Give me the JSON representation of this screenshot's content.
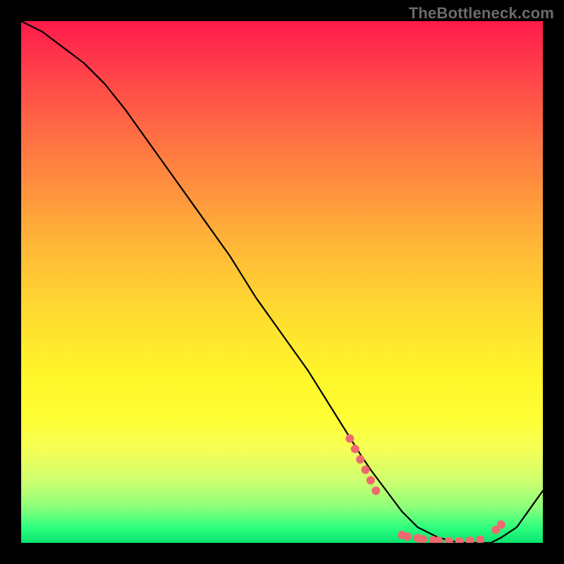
{
  "watermark": "TheBottleneck.com",
  "chart_data": {
    "type": "line",
    "title": "",
    "xlabel": "",
    "ylabel": "",
    "xlim": [
      0,
      100
    ],
    "ylim": [
      0,
      100
    ],
    "series": [
      {
        "name": "curve",
        "x": [
          0,
          4,
          8,
          12,
          16,
          20,
          25,
          30,
          35,
          40,
          45,
          50,
          55,
          60,
          65,
          67,
          70,
          73,
          76,
          80,
          84,
          88,
          90,
          92,
          95,
          100
        ],
        "y": [
          100,
          98,
          95,
          92,
          88,
          83,
          76,
          69,
          62,
          55,
          47,
          40,
          33,
          25,
          17,
          14,
          10,
          6,
          3,
          1,
          0,
          0,
          0,
          1,
          3,
          10
        ]
      }
    ],
    "markers": [
      {
        "x": 63,
        "y": 20
      },
      {
        "x": 64,
        "y": 18
      },
      {
        "x": 65,
        "y": 16
      },
      {
        "x": 66,
        "y": 14
      },
      {
        "x": 67,
        "y": 12
      },
      {
        "x": 68,
        "y": 10
      },
      {
        "x": 73,
        "y": 1.5
      },
      {
        "x": 74,
        "y": 1.2
      },
      {
        "x": 76,
        "y": 0.9
      },
      {
        "x": 77,
        "y": 0.7
      },
      {
        "x": 79,
        "y": 0.5
      },
      {
        "x": 80,
        "y": 0.4
      },
      {
        "x": 82,
        "y": 0.3
      },
      {
        "x": 84,
        "y": 0.3
      },
      {
        "x": 86,
        "y": 0.4
      },
      {
        "x": 88,
        "y": 0.6
      },
      {
        "x": 91,
        "y": 2.5
      },
      {
        "x": 92,
        "y": 3.5
      }
    ],
    "colors": {
      "curve": "#000000",
      "markers": "#ee6a70",
      "gradient_top": "#ff1a4b",
      "gradient_mid": "#fff62a",
      "gradient_bottom": "#08e46e"
    }
  }
}
